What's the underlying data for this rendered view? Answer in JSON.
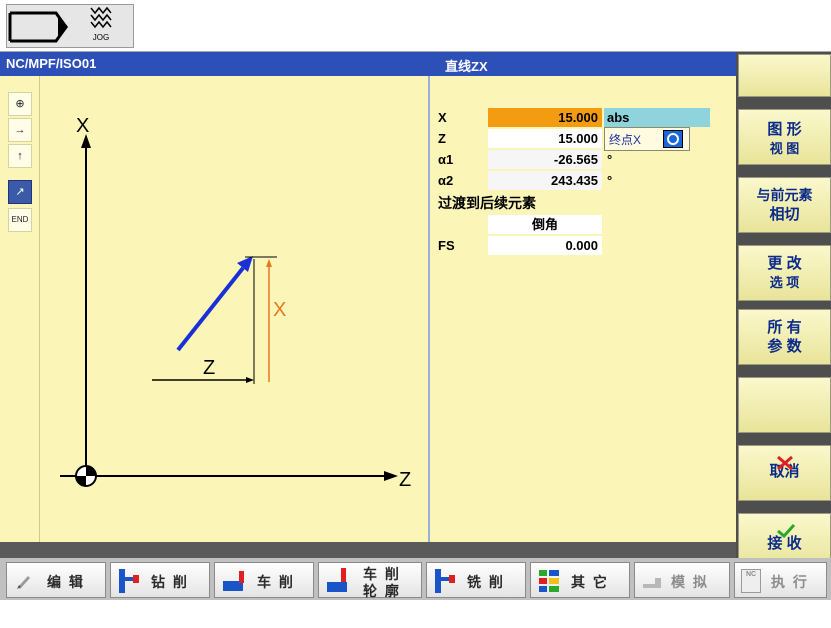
{
  "header": {
    "mode_label": "JOG"
  },
  "titlebar": {
    "path": "NC/MPF/ISO01",
    "form_title": "直线ZX"
  },
  "left_tools": [
    {
      "icon": "pole-icon",
      "glyph": "⊕"
    },
    {
      "icon": "horizontal-line-icon",
      "glyph": "→"
    },
    {
      "icon": "vertical-line-icon",
      "glyph": "↑"
    },
    {
      "icon": "diagonal-line-icon",
      "glyph": "↗"
    },
    {
      "icon": "end-icon",
      "glyph": "END"
    }
  ],
  "graphic": {
    "axis_x": "X",
    "axis_z": "Z",
    "dim_x": "X",
    "dim_z": "Z"
  },
  "form": {
    "x": {
      "label": "X",
      "value": "15.000",
      "unit": "abs"
    },
    "z": {
      "label": "Z",
      "value": "15.000",
      "tooltip": "终点X"
    },
    "a1": {
      "label": "α1",
      "value": "-26.565",
      "unit": "°"
    },
    "a2": {
      "label": "α2",
      "value": "243.435",
      "unit": "°"
    },
    "transition": {
      "label": "过渡到后续元素",
      "value": "倒角"
    },
    "fs": {
      "label": "FS",
      "value": "0.000"
    }
  },
  "side_buttons": [
    {
      "l1": "",
      "l2": ""
    },
    {
      "l1": "图 形",
      "l2": "视 图"
    },
    {
      "l1": "与前元素",
      "l2": "相切"
    },
    {
      "l1": "更 改",
      "l2": "选 项"
    },
    {
      "l1": "所 有",
      "l2": "参 数"
    },
    {
      "l1": "",
      "l2": ""
    },
    {
      "l1": "取消",
      "l2": ""
    },
    {
      "l1": "接 收",
      "l2": ""
    }
  ],
  "bottom_buttons": [
    {
      "label": "编 辑"
    },
    {
      "label": "钻 削"
    },
    {
      "label": "车 削"
    },
    {
      "label_top": "车 削",
      "label_bottom": "轮 廓"
    },
    {
      "label": "铣 削"
    },
    {
      "label": "其 它"
    },
    {
      "label": "模 拟"
    },
    {
      "label": "执 行",
      "badge": "NC"
    }
  ],
  "colors": {
    "title_bg": "#2d4fb8",
    "pane_bg": "#fbf6b8",
    "highlight": "#f39c12",
    "abs_bg": "#8fd3dc",
    "softkey_text": "#0b2b8a",
    "vector": "#1a2fd6",
    "dim_x": "#e8781e"
  }
}
